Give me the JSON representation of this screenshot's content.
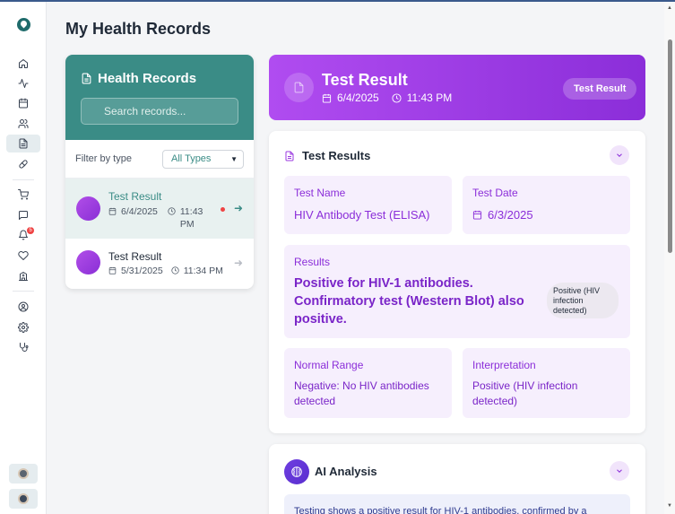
{
  "page": {
    "title": "My Health Records"
  },
  "sidebar": {
    "items": [
      {
        "name": "home-icon"
      },
      {
        "name": "activity-icon"
      },
      {
        "name": "calendar-icon"
      },
      {
        "name": "users-icon"
      },
      {
        "name": "file-icon",
        "active": true
      },
      {
        "name": "pill-icon"
      },
      {
        "name": "cart-icon"
      },
      {
        "name": "chat-icon"
      },
      {
        "name": "bell-icon",
        "badge": "5"
      },
      {
        "name": "heart-icon"
      },
      {
        "name": "hospital-icon"
      },
      {
        "name": "user-circle-icon"
      },
      {
        "name": "gear-icon"
      },
      {
        "name": "stethoscope-icon"
      }
    ],
    "bell_badge": "5"
  },
  "records_panel": {
    "title": "Health Records",
    "search_placeholder": "Search records...",
    "filter_label": "Filter by type",
    "filter_value": "All Types",
    "records": [
      {
        "title": "Test Result",
        "date": "6/4/2025",
        "time": "11:43 PM",
        "selected": true,
        "unread": true
      },
      {
        "title": "Test Result",
        "date": "5/31/2025",
        "time": "11:34 PM",
        "selected": false,
        "unread": false
      }
    ]
  },
  "detail_header": {
    "title": "Test Result",
    "date": "6/4/2025",
    "time": "11:43 PM",
    "tag": "Test Result"
  },
  "test_results": {
    "section_title": "Test Results",
    "test_name_label": "Test Name",
    "test_name": "HIV Antibody Test (ELISA)",
    "test_date_label": "Test Date",
    "test_date": "6/3/2025",
    "results_label": "Results",
    "results": "Positive for HIV-1 antibodies. Confirmatory test (Western Blot) also positive.",
    "results_tag": "Positive (HIV infection detected)",
    "normal_range_label": "Normal Range",
    "normal_range": "Negative: No HIV antibodies detected",
    "interpretation_label": "Interpretation",
    "interpretation": "Positive (HIV infection detected)"
  },
  "ai_analysis": {
    "title": "AI Analysis",
    "text": "Testing shows a positive result for HIV-1 antibodies, confirmed by a"
  },
  "colors": {
    "teal": "#3a8c86",
    "purple": "#8b2ed9",
    "purple_light": "#f6effd",
    "alert_red": "#ef4444"
  }
}
